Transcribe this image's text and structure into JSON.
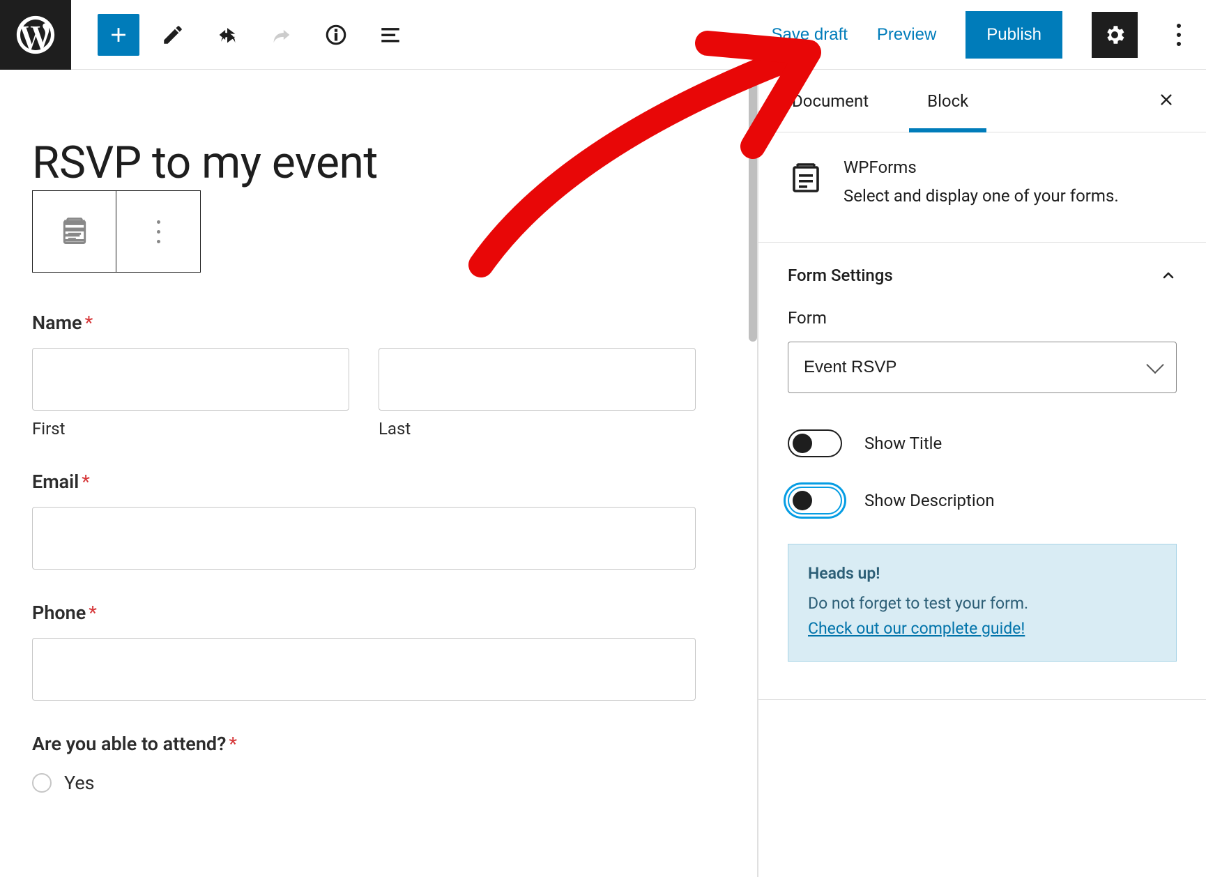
{
  "toolbar": {
    "save_draft_label": "Save draft",
    "preview_label": "Preview",
    "publish_label": "Publish"
  },
  "editor": {
    "page_title": "RSVP to my event",
    "fields": {
      "name": {
        "label": "Name",
        "required": true,
        "first_sub": "First",
        "last_sub": "Last"
      },
      "email": {
        "label": "Email",
        "required": true
      },
      "phone": {
        "label": "Phone",
        "required": true
      },
      "attend": {
        "label": "Are you able to attend?",
        "required": true,
        "options": [
          "Yes"
        ]
      }
    }
  },
  "sidebar": {
    "tabs": {
      "document": "Document",
      "block": "Block"
    },
    "block": {
      "name": "WPForms",
      "description": "Select and display one of your forms."
    },
    "form_settings": {
      "title": "Form Settings",
      "form_label": "Form",
      "form_selected": "Event RSVP",
      "show_title_label": "Show Title",
      "show_description_label": "Show Description"
    },
    "notice": {
      "title": "Heads up!",
      "body": "Do not forget to test your form.",
      "link": "Check out our complete guide!"
    }
  }
}
